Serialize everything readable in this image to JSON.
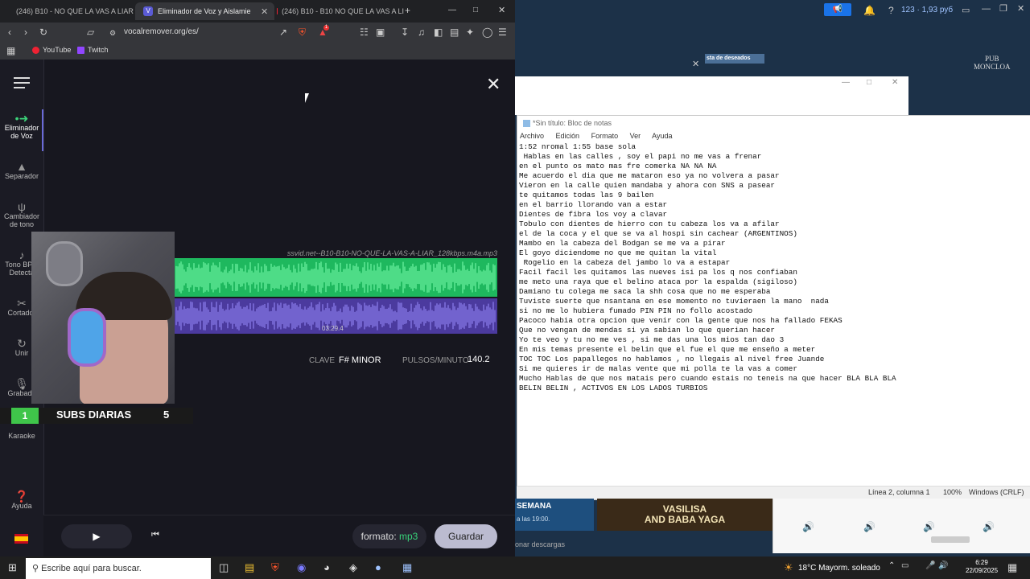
{
  "browser": {
    "tabs": [
      {
        "label": "(246) B10 - NO QUE LA VAS A LIAR (O",
        "active": false
      },
      {
        "label": "Eliminador de Voz y Aislamiento",
        "active": true
      },
      {
        "label": "(246) B10 - B10 NO QUE LA VAS A LI",
        "active": false
      }
    ],
    "url": "vocalremover.org/es/",
    "notif_badge": "1",
    "bookmarks": [
      "YouTube",
      "Twitch"
    ]
  },
  "app": {
    "sidebar": [
      {
        "label": "Eliminador de Voz",
        "icon": "vocal-remover-icon",
        "active": true
      },
      {
        "label": "Separador",
        "icon": "splitter-icon"
      },
      {
        "label": "Cambiador de tono",
        "icon": "pitch-icon"
      },
      {
        "label": "Tono BPM Detecta",
        "icon": "bpm-icon"
      },
      {
        "label": "Cortador",
        "icon": "scissors-icon"
      },
      {
        "label": "Unir",
        "icon": "join-icon"
      },
      {
        "label": "Grabado",
        "icon": "mic-icon"
      },
      {
        "label": "Karaoke",
        "icon": "karaoke-icon"
      },
      {
        "label": "Ayuda",
        "icon": "help-icon"
      }
    ],
    "filename": "ssvid.net--B10-B10-NO-QUE-LA-VAS-A-LIAR_128kbps.m4a.mp3",
    "timecode": "03:29.4",
    "key_label": "CLAVE",
    "key_value": "F# MINOR",
    "bpm_label": "PULSOS/MINUTO",
    "bpm_value": "140.2",
    "format_label": "formato:",
    "format_value": "mp3",
    "save_label": "Guardar",
    "colors": {
      "vocals": "#1eb85e",
      "music": "#4b3a9e"
    }
  },
  "overlay": {
    "subs_number": "1",
    "subs_label": "SUBS DIARIAS",
    "subs_count": "5"
  },
  "steam": {
    "wishlist": "sta de deseados",
    "pub": "PUB\nMONCLOA",
    "semana": "SEMANA",
    "hour": "a las 19:00.",
    "vasilisa": "VASILISA\nAND BABA YAGA",
    "downloads": "onar descargas"
  },
  "notepad": {
    "title": "*Sin título: Bloc de notas",
    "menu": [
      "Archivo",
      "Edición",
      "Formato",
      "Ver",
      "Ayuda"
    ],
    "lines": [
      "1:52 nromal 1:55 base sola",
      " Hablas en las calles , soy el papi no me vas a frenar",
      "en el punto os mato mas fre comerka NA NA NA",
      "Me acuerdo el dia que me mataron eso ya no volvera a pasar",
      "Vieron en la calle quien mandaba y ahora con SNS a pasear",
      "te quitamos todas las 9 bailen",
      "en el barrio llorando van a estar",
      "Dientes de fibra los voy a clavar",
      "Tobulo con dientes de hierro con tu cabeza los va a afilar",
      "el de la coca y el que se va al hospi sin cachear (ARGENTINOS)",
      "Mambo en la cabeza del Bodgan se me va a pirar",
      "El goyo diciendome no que me quitan la vital",
      " Rogelio en la cabeza del jambo lo va a estapar",
      "Facil facil les quitamos las nueves isi pa los q nos confiaban",
      "me meto una raya que el belino ataca por la espalda (sigiloso)",
      "Damiano tu colega me saca la shh cosa que no me esperaba",
      "Tuviste suerte que nsantana en ese momento no tuvieraen la mano  nada",
      "si no me lo hubiera fumado PIN PIN no follo acostado",
      "Pacoco habia otra opcion que venir con la gente que nos ha fallado FEKAS",
      "Que no vengan de mendas si ya sabian lo que querian hacer",
      "Yo te veo y tu no me ves , si me das una los mios tan dao 3",
      "En mis temas presente el belin que el fue el que me enseño a meter",
      "TOC TOC Los papallegos no hablamos , no llegais al nivel free Juande",
      "Si me quieres ir de malas vente que mi polla te la vas a comer",
      "Mucho Hablas de que nos matais pero cuando estais no teneis na que hacer BLA BLA BLA",
      "BELIN BELIN , ACTIVOS EN LOS LADOS TURBIOS"
    ],
    "status_pos": "Línea 2, columna 1",
    "status_zoom": "100%",
    "status_enc": "Windows (CRLF)"
  },
  "taskbar": {
    "search": "Escribe aquí para buscar.",
    "weather": "18°C  Mayorm. soleado",
    "time": "6:29",
    "date": "22/09/2025"
  },
  "topright": {
    "balance": "123 · 1,93 руб"
  }
}
